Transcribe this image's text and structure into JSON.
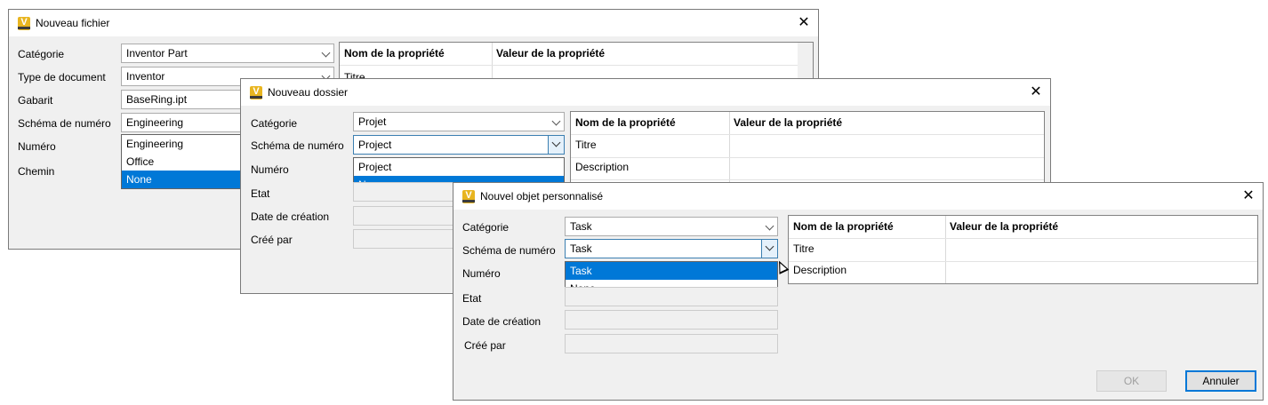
{
  "app_icon": {
    "letter": "V",
    "name": "vault-icon"
  },
  "dialog1": {
    "title": "Nouveau fichier",
    "labels": [
      "Catégorie",
      "Type de document",
      "Gabarit",
      "Schéma de numéro",
      "Numéro",
      "Chemin"
    ],
    "fields": {
      "category": "Inventor Part",
      "doc_type": "Inventor",
      "template": "BaseRing.ipt",
      "numbering": "Engineering"
    },
    "dropdown": [
      "Engineering",
      "Office",
      "None"
    ],
    "dropdown_selected": "None",
    "grid": {
      "headers": [
        "Nom de la propriété",
        "Valeur de la propriété"
      ],
      "rows": [
        "Titre"
      ]
    }
  },
  "dialog2": {
    "title": "Nouveau dossier",
    "labels": [
      "Catégorie",
      "Schéma de numéro",
      "Numéro",
      "Etat",
      "Date de création",
      "Créé par"
    ],
    "fields": {
      "category": "Projet",
      "numbering": "Project"
    },
    "dropdown": [
      "Project",
      "None"
    ],
    "dropdown_selected": "None",
    "grid": {
      "headers": [
        "Nom de la propriété",
        "Valeur de la propriété"
      ],
      "rows": [
        "Titre",
        "Description"
      ]
    }
  },
  "dialog3": {
    "title": "Nouvel objet personnalisé",
    "labels": [
      "Catégorie",
      "Schéma de numéro",
      "Numéro",
      "Etat",
      "Date de création",
      "Créé par"
    ],
    "fields": {
      "category": "Task",
      "numbering": "Task"
    },
    "dropdown": [
      "Task",
      "None"
    ],
    "dropdown_selected": "Task",
    "grid": {
      "headers": [
        "Nom de la propriété",
        "Valeur de la propriété"
      ],
      "rows": [
        "Titre",
        "Description"
      ]
    },
    "buttons": {
      "ok": "OK",
      "cancel": "Annuler"
    }
  }
}
